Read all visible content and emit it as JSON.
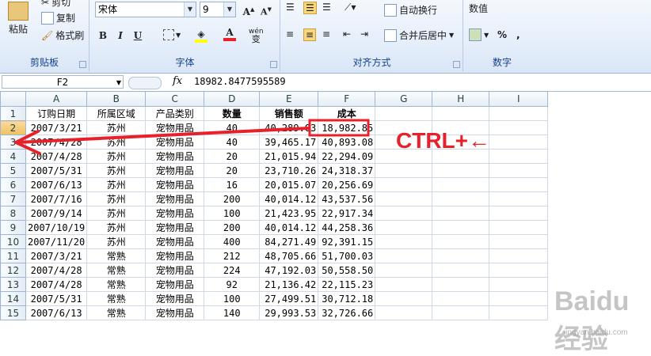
{
  "clipboard": {
    "paste": "粘贴",
    "cut": "剪切",
    "copy": "复制",
    "format_painter": "格式刷",
    "group_label": "剪贴板"
  },
  "font": {
    "font_name": "宋体",
    "font_size": "9",
    "bold": "B",
    "italic": "I",
    "underline": "U",
    "font_color": "A",
    "phonetic": "wén",
    "group_label": "字体"
  },
  "alignment": {
    "wrap_text": "自动换行",
    "merge_center": "合并后居中",
    "group_label": "对齐方式"
  },
  "number": {
    "format": "数值",
    "percent": "%",
    "comma": ",",
    "group_label": "数字"
  },
  "formula_bar": {
    "name_box": "F2",
    "fx": "fx",
    "value": "18982.8477595589"
  },
  "columns": [
    "A",
    "B",
    "C",
    "D",
    "E",
    "F",
    "G",
    "H",
    "I"
  ],
  "headers": [
    "订购日期",
    "所属区域",
    "产品类别",
    "数量",
    "销售额",
    "成本"
  ],
  "rows": [
    [
      "2007/3/21",
      "苏州",
      "宠物用品",
      "40",
      "40,289.03",
      "18,982.85"
    ],
    [
      "2007/4/28",
      "苏州",
      "宠物用品",
      "40",
      "39,465.17",
      "40,893.08"
    ],
    [
      "2007/4/28",
      "苏州",
      "宠物用品",
      "20",
      "21,015.94",
      "22,294.09"
    ],
    [
      "2007/5/31",
      "苏州",
      "宠物用品",
      "20",
      "23,710.26",
      "24,318.37"
    ],
    [
      "2007/6/13",
      "苏州",
      "宠物用品",
      "16",
      "20,015.07",
      "20,256.69"
    ],
    [
      "2007/7/16",
      "苏州",
      "宠物用品",
      "200",
      "40,014.12",
      "43,537.56"
    ],
    [
      "2007/9/14",
      "苏州",
      "宠物用品",
      "100",
      "21,423.95",
      "22,917.34"
    ],
    [
      "2007/10/19",
      "苏州",
      "宠物用品",
      "200",
      "40,014.12",
      "44,258.36"
    ],
    [
      "2007/11/20",
      "苏州",
      "宠物用品",
      "400",
      "84,271.49",
      "92,391.15"
    ],
    [
      "2007/3/21",
      "常熟",
      "宠物用品",
      "212",
      "48,705.66",
      "51,700.03"
    ],
    [
      "2007/4/28",
      "常熟",
      "宠物用品",
      "224",
      "47,192.03",
      "50,558.50"
    ],
    [
      "2007/4/28",
      "常熟",
      "宠物用品",
      "92",
      "21,136.42",
      "22,115.23"
    ],
    [
      "2007/5/31",
      "常熟",
      "宠物用品",
      "100",
      "27,499.51",
      "30,712.18"
    ],
    [
      "2007/6/13",
      "常熟",
      "宠物用品",
      "140",
      "29,993.53",
      "32,726.66"
    ]
  ],
  "annotation": {
    "text": "CTRL+←",
    "color": "#e8202a"
  },
  "watermark": {
    "text": "Baidu经验",
    "sub": "jingyan.baidu.com"
  }
}
